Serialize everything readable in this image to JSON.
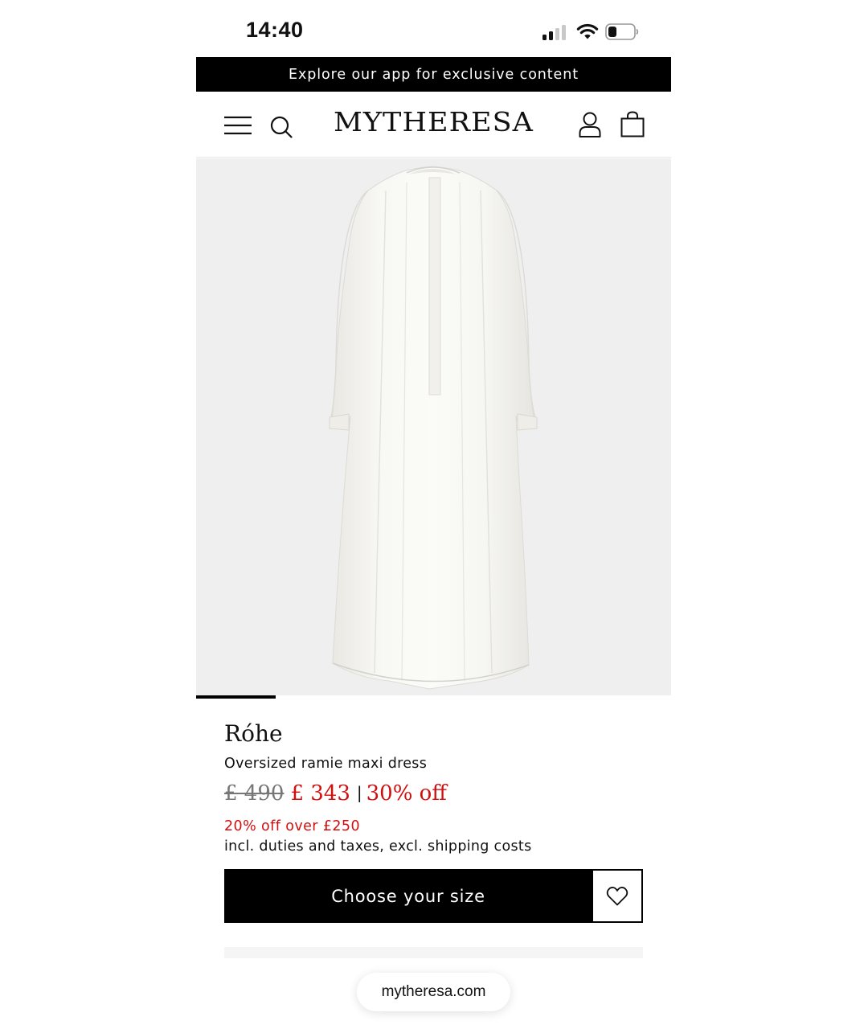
{
  "status_bar": {
    "time": "14:40",
    "icons": [
      "signal-icon",
      "wifi-icon",
      "battery-icon"
    ]
  },
  "banner": {
    "text": "Explore our app for exclusive content"
  },
  "header": {
    "logo": "MYTHERESA",
    "icons": [
      "menu-icon",
      "search-icon",
      "account-icon",
      "shopping-bag-icon"
    ]
  },
  "product": {
    "image_alt": "white oversized dress photo",
    "image_progress": 0.167,
    "brand": "Róhe",
    "name": "Oversized ramie maxi dress",
    "price_old": "£ 490",
    "price_new": "£ 343",
    "price_separator": "|",
    "discount": "30% off",
    "promo": "20% off over £250",
    "tax_note": "incl. duties and taxes, excl. shipping costs"
  },
  "actions": {
    "size_button": "Choose your size",
    "wishlist_icon": "heart-icon"
  },
  "browser": {
    "url": "mytheresa.com"
  },
  "colors": {
    "accent_sale": "#d10f0f",
    "banner_bg": "#000000",
    "image_bg": "#efefef"
  }
}
